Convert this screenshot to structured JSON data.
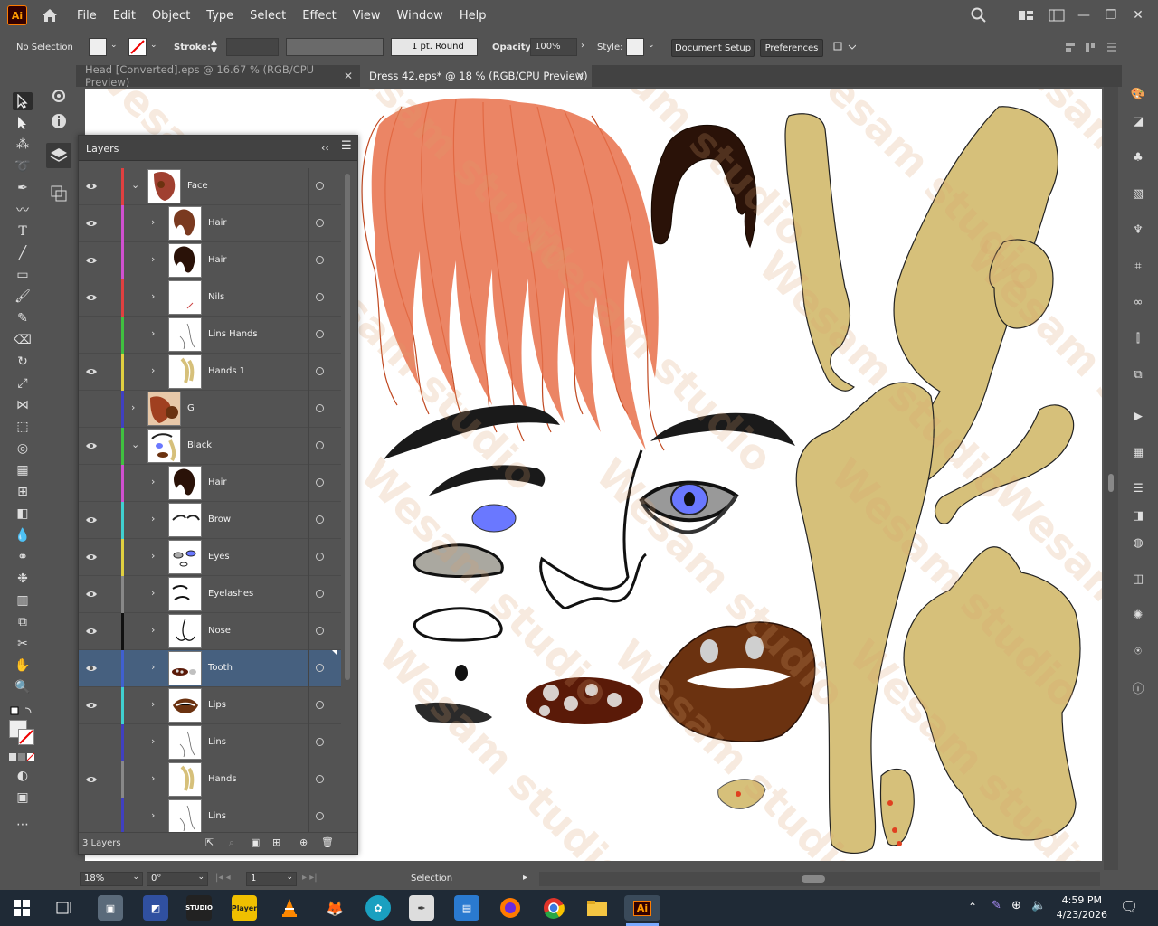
{
  "app": {
    "logo": "Ai",
    "name": "Adobe Illustrator"
  },
  "menu": [
    "File",
    "Edit",
    "Object",
    "Type",
    "Select",
    "Effect",
    "View",
    "Window",
    "Help"
  ],
  "control_bar": {
    "selection_label": "No Selection",
    "stroke_label": "Stroke:",
    "stroke_profile": "1 pt. Round",
    "opacity_label": "Opacity:",
    "opacity_value": "100%",
    "style_label": "Style:",
    "document_setup": "Document Setup",
    "preferences": "Preferences"
  },
  "tabs": [
    {
      "label": "Head [Converted].eps @ 16.67 % (RGB/CPU Preview)",
      "active": false
    },
    {
      "label": "Dress 42.eps* @ 18 % (RGB/CPU Preview)",
      "active": true
    }
  ],
  "layers_panel": {
    "title": "Layers",
    "footer_count": "3 Layers",
    "rows": [
      {
        "name": "Face",
        "visible": true,
        "expanded": true,
        "indent": 0,
        "color": "#e04040",
        "thumb": "face"
      },
      {
        "name": "Hair",
        "visible": true,
        "indent": 1,
        "color": "#d050d0",
        "thumb": "hair-brown"
      },
      {
        "name": "Hair",
        "visible": true,
        "indent": 1,
        "color": "#d050d0",
        "thumb": "hair-dark"
      },
      {
        "name": "Nils",
        "visible": true,
        "indent": 1,
        "color": "#e04040",
        "thumb": "blank"
      },
      {
        "name": "Lins Hands",
        "visible": false,
        "indent": 1,
        "color": "#40c040",
        "thumb": "lines"
      },
      {
        "name": "Hands 1",
        "visible": true,
        "indent": 1,
        "color": "#e0d040",
        "thumb": "hands"
      },
      {
        "name": "G",
        "visible": false,
        "expanded": false,
        "indent": 0,
        "color": "#4040c0",
        "thumb": "g"
      },
      {
        "name": "Black",
        "visible": true,
        "expanded": true,
        "indent": 0,
        "color": "#40c040",
        "thumb": "black"
      },
      {
        "name": "Hair",
        "visible": false,
        "indent": 1,
        "color": "#d050d0",
        "thumb": "hair-dark"
      },
      {
        "name": "Brow",
        "visible": true,
        "indent": 1,
        "color": "#40d0d0",
        "thumb": "brow"
      },
      {
        "name": "Eyes",
        "visible": true,
        "indent": 1,
        "color": "#e0d040",
        "thumb": "eyes"
      },
      {
        "name": "Eyelashes",
        "visible": true,
        "indent": 1,
        "color": "#888888",
        "thumb": "lashes"
      },
      {
        "name": "Nose",
        "visible": true,
        "indent": 1,
        "color": "#111111",
        "thumb": "nose"
      },
      {
        "name": "Tooth",
        "visible": true,
        "indent": 1,
        "color": "#4060d0",
        "thumb": "tooth",
        "selected": true
      },
      {
        "name": "Lips",
        "visible": true,
        "indent": 1,
        "color": "#40d0d0",
        "thumb": "lips"
      },
      {
        "name": "Lins",
        "visible": false,
        "indent": 1,
        "color": "#4040c0",
        "thumb": "lines"
      },
      {
        "name": "Hands",
        "visible": true,
        "indent": 1,
        "color": "#888888",
        "thumb": "hands"
      },
      {
        "name": "Lins",
        "visible": false,
        "indent": 1,
        "color": "#4040c0",
        "thumb": "lines"
      }
    ]
  },
  "watermark": "Wesam studio",
  "status_bar": {
    "zoom": "18%",
    "rotation": "0°",
    "artboard": "1",
    "tool": "Selection"
  },
  "taskbar": {
    "time": "4:59 PM",
    "date": "4/23/2026",
    "studio_label": "STUDIO",
    "player_label": "Player",
    "ai_label": "Ai"
  },
  "colors": {
    "ui_bg": "#535353",
    "panel_dark": "#424242",
    "selected_row": "#46607f",
    "skin": "#d6c07a",
    "hair_orange": "#e8704a",
    "hair_dark": "#2a1208",
    "lips": "#6b3210",
    "eye_blue": "#6a78ff"
  }
}
